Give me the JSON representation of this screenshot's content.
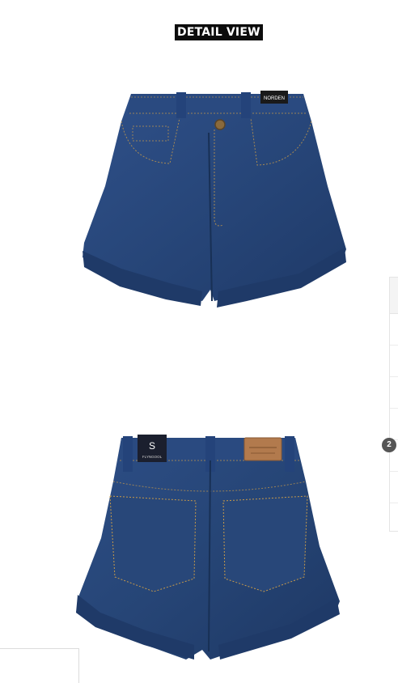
{
  "section_title": "DETAIL VIEW",
  "front_tag_text": "NORDEN",
  "back_tag_size": "S",
  "back_tag_brand": "FLYNGOOL",
  "pagination_badge": "2",
  "colors": {
    "denim": "#2b4a7f",
    "denim_dark": "#1e3762",
    "stitch": "#c79a4a",
    "leather_patch": "#b27a4d",
    "title_bg": "#0c0c0c"
  }
}
